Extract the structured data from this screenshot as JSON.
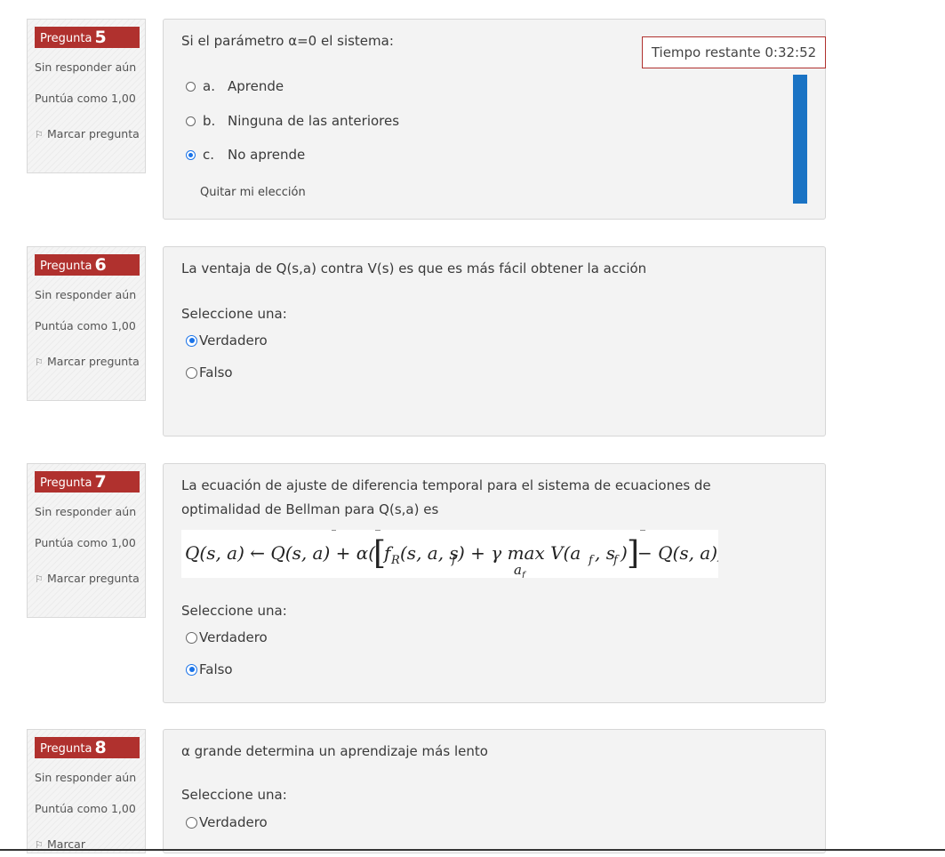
{
  "timer": {
    "text": "Tiempo restante 0:32:52"
  },
  "questions": [
    {
      "label": "Pregunta",
      "number": "5",
      "state": "Sin responder aún",
      "grade": "Puntúa como 1,00",
      "flag": "Marcar pregunta",
      "text": "Si el parámetro α=0 el sistema:",
      "options": [
        {
          "letter": "a.",
          "label": "Aprende",
          "checked": false
        },
        {
          "letter": "b.",
          "label": "Ninguna de las anteriores",
          "checked": false
        },
        {
          "letter": "c.",
          "label": "No aprende",
          "checked": true
        }
      ],
      "clear": "Quitar mi elección"
    },
    {
      "label": "Pregunta",
      "number": "6",
      "state": "Sin responder aún",
      "grade": "Puntúa como 1,00",
      "flag": "Marcar pregunta",
      "text": "La ventaja de Q(s,a) contra V(s) es que es más fácil obtener la acción",
      "prompt": "Seleccione una:",
      "options": [
        {
          "label": "Verdadero",
          "checked": true
        },
        {
          "label": "Falso",
          "checked": false
        }
      ]
    },
    {
      "label": "Pregunta",
      "number": "7",
      "state": "Sin responder aún",
      "grade": "Puntúa como 1,00",
      "flag": "Marcar pregunta",
      "text": "La ecuación de ajuste de diferencia temporal para el sistema de ecuaciones de optimalidad de Bellman para Q(s,a) es",
      "prompt": "Seleccione una:",
      "options": [
        {
          "label": "Verdadero",
          "checked": false
        },
        {
          "label": "Falso",
          "checked": true
        }
      ]
    },
    {
      "label": "Pregunta",
      "number": "8",
      "state": "Sin responder aún",
      "grade": "Puntúa como 1,00",
      "flag": "Marcar",
      "text": "α grande determina un aprendizaje más lento",
      "prompt": "Seleccione una:",
      "options": [
        {
          "label": "Verdadero",
          "checked": false
        }
      ]
    }
  ],
  "colors": {
    "badge": "#b0312e",
    "radio_checked": "#1a73e8",
    "bar": "#1a73c4"
  }
}
